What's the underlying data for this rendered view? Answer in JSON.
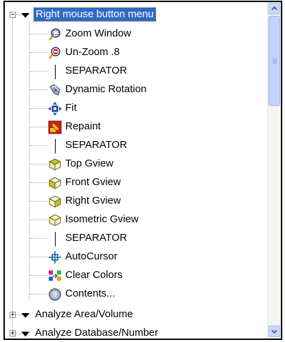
{
  "tree": {
    "root": {
      "label": "Right mouse button menu",
      "expanded": true
    },
    "items": [
      {
        "label": "Zoom Window",
        "icon": "zoom-window-icon"
      },
      {
        "label": "Un-Zoom .8",
        "icon": "unzoom-icon"
      },
      {
        "label": "SEPARATOR",
        "icon": "separator-line"
      },
      {
        "label": "Dynamic Rotation",
        "icon": "dynamic-rotation-icon"
      },
      {
        "label": "Fit",
        "icon": "fit-icon"
      },
      {
        "label": "Repaint",
        "icon": "repaint-icon"
      },
      {
        "label": "SEPARATOR",
        "icon": "separator-line"
      },
      {
        "label": "Top Gview",
        "icon": "top-gview-icon"
      },
      {
        "label": "Front Gview",
        "icon": "front-gview-icon"
      },
      {
        "label": "Right Gview",
        "icon": "right-gview-icon"
      },
      {
        "label": "Isometric Gview",
        "icon": "isometric-gview-icon"
      },
      {
        "label": "SEPARATOR",
        "icon": "separator-line"
      },
      {
        "label": "AutoCursor",
        "icon": "autocursor-icon"
      },
      {
        "label": "Clear Colors",
        "icon": "clear-colors-icon"
      },
      {
        "label": "Contents...",
        "icon": "help-contents-icon"
      }
    ],
    "siblings": [
      {
        "label": "Analyze Area/Volume",
        "expanded": false
      },
      {
        "label": "Analyze Database/Number",
        "expanded": false
      }
    ]
  },
  "colors": {
    "selection": "#316ac5",
    "scrollbar": "#c2d3fc"
  }
}
